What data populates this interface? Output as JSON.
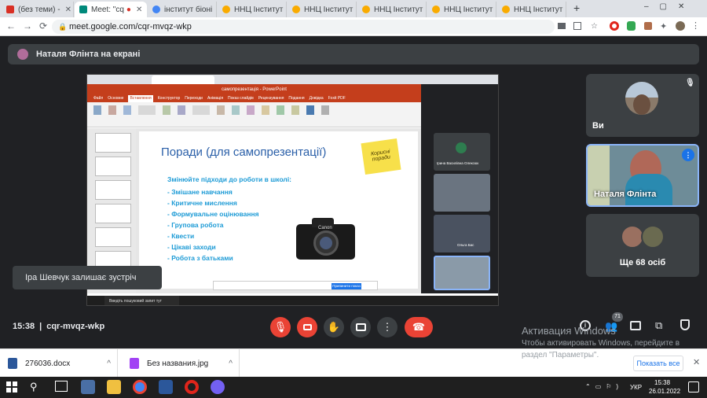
{
  "browser": {
    "tabs": [
      {
        "label": "(без теми) - ",
        "color": "#d93025"
      },
      {
        "label": "Meet: \"cq",
        "color": "#00897b"
      },
      {
        "label": "інститут біоні",
        "color": "#4285f4"
      },
      {
        "label": "ННЦ Інститут",
        "color": "#f9ab00"
      },
      {
        "label": "ННЦ Інститут",
        "color": "#f9ab00"
      },
      {
        "label": "ННЦ Інститут",
        "color": "#f9ab00"
      },
      {
        "label": "ННЦ Інститут",
        "color": "#f9ab00"
      },
      {
        "label": "ННЦ Інститут",
        "color": "#f9ab00"
      }
    ],
    "url": "meet.google.com/cqr-mvqz-wkp"
  },
  "meet": {
    "presenter_banner": "Наталя Флінта на екрані",
    "toast": "Іра Шевчук залишає зустріч",
    "time": "15:38",
    "meeting_code": "cqr-mvqz-wkp",
    "participant_count": "71",
    "tiles": [
      {
        "name": "Ви"
      },
      {
        "name": "Наталя Флінта"
      },
      {
        "name": "Ще 68 осіб"
      }
    ]
  },
  "slide": {
    "title": "Поради (для самопрезентації)",
    "subtitle": "Змінюйте підходи до роботи в школі:",
    "items": [
      "- Змішане навчання",
      "- Критичне мислення",
      "- Формувальне оцінювання",
      "- Групова робота",
      "- Квести",
      "- Цікаві заходи",
      "- Робота з батьками"
    ],
    "sticky_note": "Корисні поради",
    "camera_brand": "Canon"
  },
  "shared_screen": {
    "ppt_title": "самопрезентація - PowerPoint",
    "ribbon_tabs": [
      "Файл",
      "Основне",
      "Вставлення",
      "Конструктор",
      "Переходи",
      "Анімація",
      "Показ слайдів",
      "Рецензування",
      "Подання",
      "Довідка",
      "Foxit PDF"
    ],
    "mini_names": [
      "Ірина Василівна Олексюк",
      "Ольга Бас"
    ],
    "notice": "Припинити показ",
    "taskbar_search": "Введіть пошуковий запит тут"
  },
  "watermark": {
    "line1": "Активация Windows",
    "line2": "Чтобы активировать Windows, перейдите в",
    "line3": "раздел \"Параметры\"."
  },
  "downloads": {
    "items": [
      "276036.docx",
      "Без названия.jpg"
    ],
    "show_all": "Показать все"
  },
  "taskbar": {
    "lang": "УКР",
    "time": "15:38",
    "date": "26.01.2022"
  }
}
